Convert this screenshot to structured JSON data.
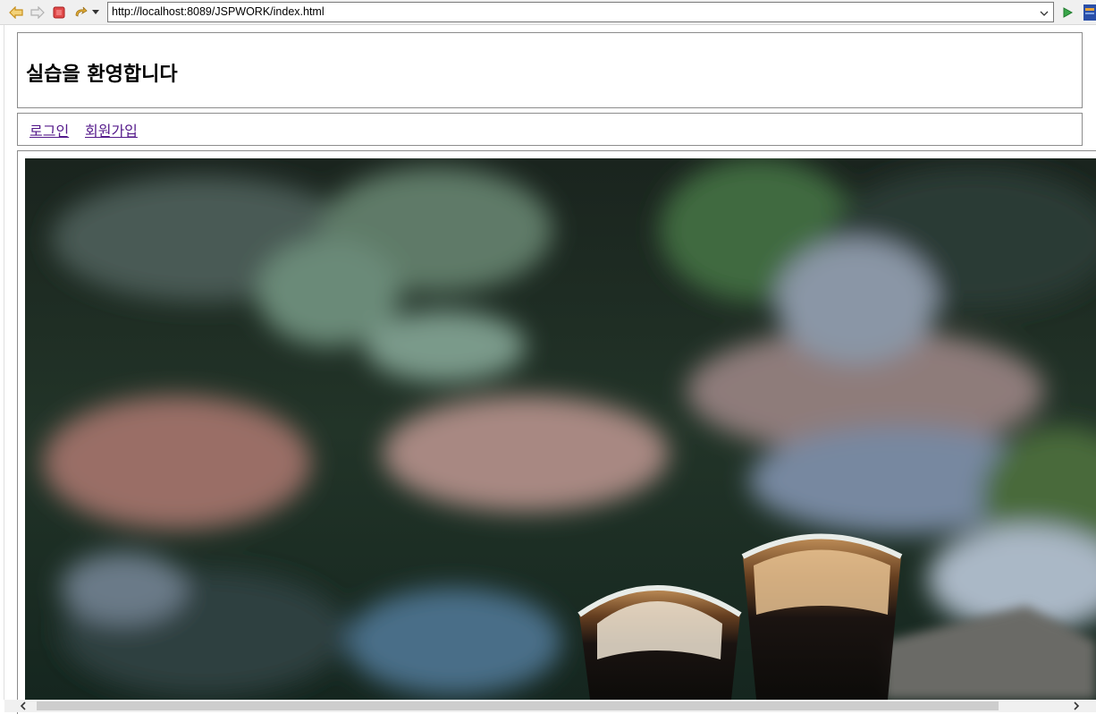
{
  "toolbar": {
    "icons": [
      "back-icon",
      "forward-icon",
      "stop-icon",
      "refresh-icon",
      "dropdown-icon",
      "go-icon",
      "extension-icon"
    ],
    "url": "http://localhost:8089/JSPWORK/index.html"
  },
  "header": {
    "title": "실습을 환영합니다"
  },
  "nav": {
    "login": "로그인",
    "join": "회원가입"
  },
  "colors": {
    "link_visited": "#551a8b",
    "border": "#8c8c8c"
  }
}
